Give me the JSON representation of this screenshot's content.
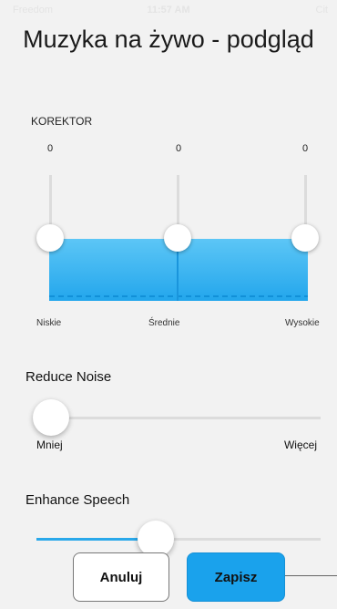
{
  "status_bar": {
    "carrier": "Freedom",
    "time": "11:57 AM",
    "right": "Cit"
  },
  "title": "Muzyka na żywo - podgląd",
  "equalizer": {
    "label": "KOREKTOR",
    "bands": [
      {
        "name": "Niskie",
        "value": "0"
      },
      {
        "name": "Średnie",
        "value": "0"
      },
      {
        "name": "Wysokie",
        "value": "0"
      }
    ]
  },
  "reduce_noise": {
    "title": "Reduce Noise",
    "min_label": "Mniej",
    "max_label": "Więcej",
    "level": 0.05
  },
  "enhance_speech": {
    "title": "Enhance Speech",
    "level": 0.42
  },
  "buttons": {
    "cancel": "Anuluj",
    "save": "Zapisz"
  },
  "colors": {
    "accent": "#1aa2ec",
    "background": "#f2f2f2"
  }
}
